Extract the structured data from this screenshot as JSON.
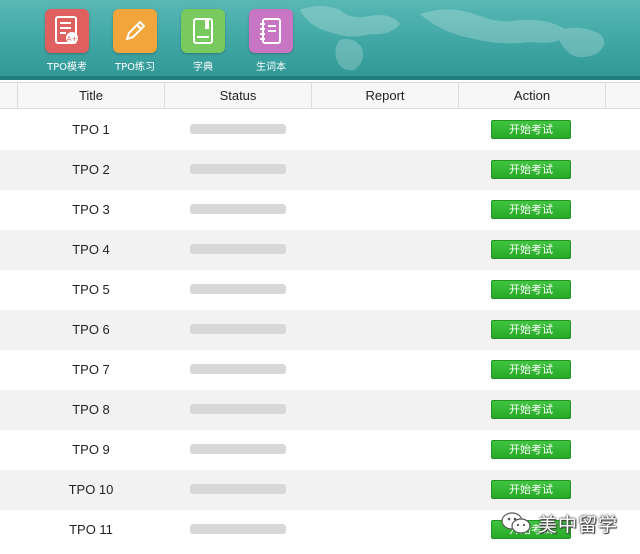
{
  "toolbar": {
    "items": [
      {
        "label": "TPO模考",
        "icon": "exam-sheet-icon",
        "color": "#e06060"
      },
      {
        "label": "TPO练习",
        "icon": "pencil-icon",
        "color": "#f2a53a"
      },
      {
        "label": "字典",
        "icon": "dictionary-book-icon",
        "color": "#78c95e"
      },
      {
        "label": "生词本",
        "icon": "notebook-icon",
        "color": "#c876c4"
      }
    ]
  },
  "table": {
    "columns": [
      "Title",
      "Status",
      "Report",
      "Action"
    ],
    "rows": [
      {
        "title": "TPO 1",
        "action": "开始考试"
      },
      {
        "title": "TPO 2",
        "action": "开始考试"
      },
      {
        "title": "TPO 3",
        "action": "开始考试"
      },
      {
        "title": "TPO 4",
        "action": "开始考试"
      },
      {
        "title": "TPO 5",
        "action": "开始考试"
      },
      {
        "title": "TPO 6",
        "action": "开始考试"
      },
      {
        "title": "TPO 7",
        "action": "开始考试"
      },
      {
        "title": "TPO 8",
        "action": "开始考试"
      },
      {
        "title": "TPO 9",
        "action": "开始考试"
      },
      {
        "title": "TPO 10",
        "action": "开始考试"
      },
      {
        "title": "TPO 11",
        "action": "开始考试"
      }
    ]
  },
  "watermark": {
    "text": "美中留学",
    "icon": "wechat-icon"
  },
  "colors": {
    "header_teal": "#3fa6a4",
    "button_green": "#2fb52f",
    "row_alt": "#f2f2f2",
    "status_placeholder": "#d8d8d8"
  }
}
